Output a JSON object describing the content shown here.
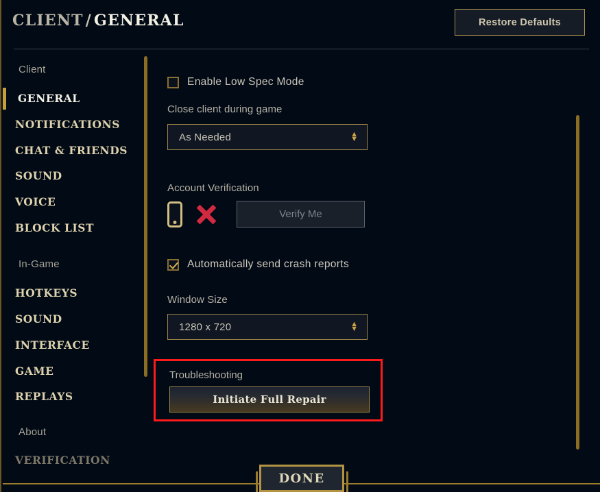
{
  "header": {
    "breadcrumb_root": "CLIENT",
    "breadcrumb_separator": "/",
    "breadcrumb_current": "GENERAL",
    "restore_defaults_label": "Restore Defaults"
  },
  "sidebar": {
    "groups": [
      {
        "label": "Client"
      },
      {
        "label": "In-Game"
      },
      {
        "label": "About"
      }
    ],
    "items": [
      {
        "label": "GENERAL",
        "active": true
      },
      {
        "label": "NOTIFICATIONS",
        "active": false
      },
      {
        "label": "CHAT & FRIENDS",
        "active": false
      },
      {
        "label": "SOUND",
        "active": false
      },
      {
        "label": "VOICE",
        "active": false
      },
      {
        "label": "BLOCK LIST",
        "active": false
      },
      {
        "label": "HOTKEYS",
        "active": false
      },
      {
        "label": "SOUND",
        "active": false
      },
      {
        "label": "INTERFACE",
        "active": false
      },
      {
        "label": "GAME",
        "active": false
      },
      {
        "label": "REPLAYS",
        "active": false
      },
      {
        "label": "VERIFICATION",
        "active": false,
        "dim": true
      }
    ]
  },
  "main": {
    "low_spec_mode": {
      "label": "Enable Low Spec Mode",
      "checked": false
    },
    "close_client": {
      "label": "Close client during game",
      "value": "As Needed"
    },
    "account_verification": {
      "label": "Account Verification",
      "phone_icon": "phone-icon",
      "status_icon": "red-x-icon",
      "verify_button_label": "Verify Me"
    },
    "crash_reports": {
      "label": "Automatically send crash reports",
      "checked": true
    },
    "window_size": {
      "label": "Window Size",
      "value": "1280 x 720"
    },
    "troubleshooting": {
      "label": "Troubleshooting",
      "repair_button_label": "Initiate Full Repair",
      "highlight_color": "#fc1b1b"
    }
  },
  "footer": {
    "done_label": "DONE"
  },
  "colors": {
    "background": "#020a16",
    "gold": "#c69f3d",
    "gold_border": "#9c8548",
    "text_light": "#cdc9bb",
    "text_gold": "#ddd2ad",
    "danger_red": "#d1293f",
    "highlight_red": "#fc1b1b"
  }
}
